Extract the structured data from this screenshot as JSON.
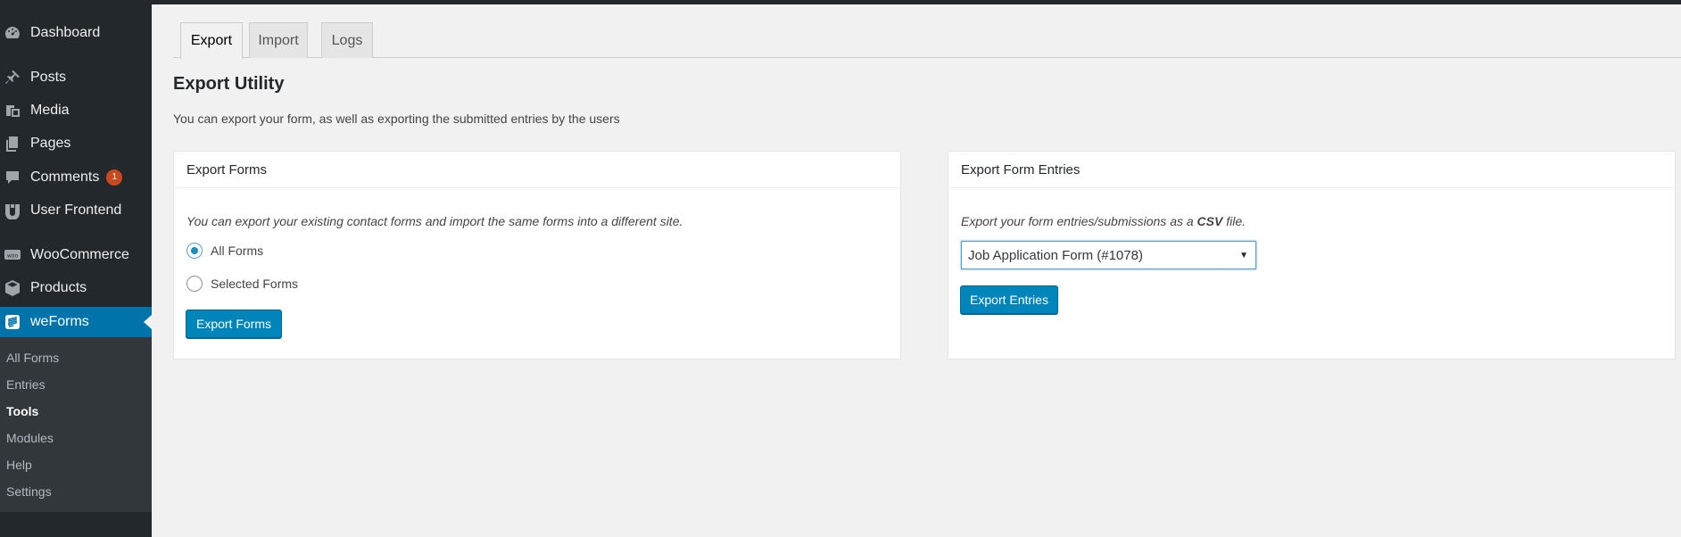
{
  "sidebar": {
    "items": [
      {
        "label": "Dashboard",
        "icon": "dashboard-icon"
      },
      {
        "label": "Posts",
        "icon": "pin-icon"
      },
      {
        "label": "Media",
        "icon": "media-icon"
      },
      {
        "label": "Pages",
        "icon": "pages-icon"
      },
      {
        "label": "Comments",
        "icon": "comment-icon",
        "badge": "1"
      },
      {
        "label": "User Frontend",
        "icon": "user-frontend-icon"
      },
      {
        "label": "WooCommerce",
        "icon": "woo-icon"
      },
      {
        "label": "Products",
        "icon": "box-icon"
      },
      {
        "label": "weForms",
        "icon": "weforms-icon"
      }
    ],
    "submenu": [
      "All Forms",
      "Entries",
      "Tools",
      "Modules",
      "Help",
      "Settings"
    ],
    "current_submenu": "Tools"
  },
  "tabs": [
    "Export",
    "Import",
    "Logs"
  ],
  "active_tab": "Export",
  "page": {
    "title": "Export Utility",
    "description": "You can export your form, as well as exporting the submitted entries by the users"
  },
  "export_forms": {
    "title": "Export Forms",
    "description": "You can export your existing contact forms and import the same forms into a different site.",
    "options": [
      "All Forms",
      "Selected Forms"
    ],
    "selected": "All Forms",
    "button": "Export Forms"
  },
  "export_entries": {
    "title": "Export Form Entries",
    "description_pre": "Export your form entries/submissions as a ",
    "description_bold": "CSV",
    "description_post": " file.",
    "select_value": "Job Application Form (#1078)",
    "button": "Export Entries"
  },
  "colors": {
    "sidebar_bg": "#23282d",
    "active_bg": "#0073aa",
    "primary_button": "#0085ba",
    "badge": "#ca4a1f"
  }
}
